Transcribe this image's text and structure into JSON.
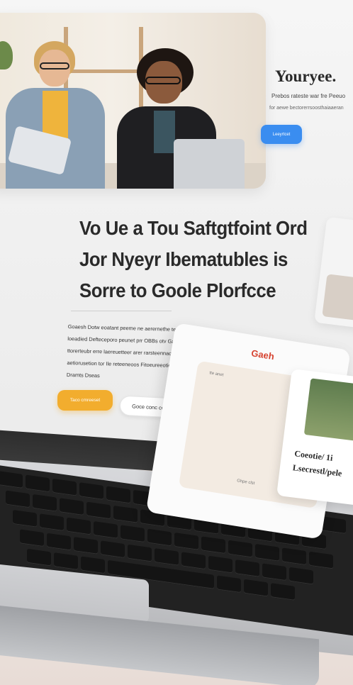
{
  "hero": {
    "title": "Youryee.",
    "subtitle_line1": "Prebos rateste war fre Peeuo",
    "subtitle_line2": "for aewe bectorerrsoosthaiaaeran",
    "button_label": "Leeyrtcet"
  },
  "main": {
    "heading_lines": [
      "Vo Ue a Tou Saftgtfoint Ord",
      "Jor Nyeyr Ibematubles is",
      "Sorre to Goole Plorfcce"
    ],
    "body_lines": [
      "Goaesh Dotw eoatant peeme ne aerernethe ter",
      "loeadied Defteceporo peunet prr OBBs otv Gaene",
      "ttorerteubr erre laereuetteer arer rarsteennaors",
      "aetiorusetion tor Ile reteeneoos Fitoeureeotien",
      "Dramts Dseas"
    ],
    "primary_button": "Taco cmreeset",
    "secondary_button": "Goce conc ccoees"
  },
  "floating_card": {
    "title": "Gaeh",
    "panel_label": "tte anet",
    "panel_footer": "Ghpe clst"
  },
  "side_card": {
    "line1": "Coeotie/ 1i",
    "line2": "Lsecrestl/pele"
  },
  "colors": {
    "hero_button": "#3a8df0",
    "primary_cta": "#f2ad2e",
    "card_title": "#d6422f",
    "heading_text": "#2a2a2a"
  }
}
